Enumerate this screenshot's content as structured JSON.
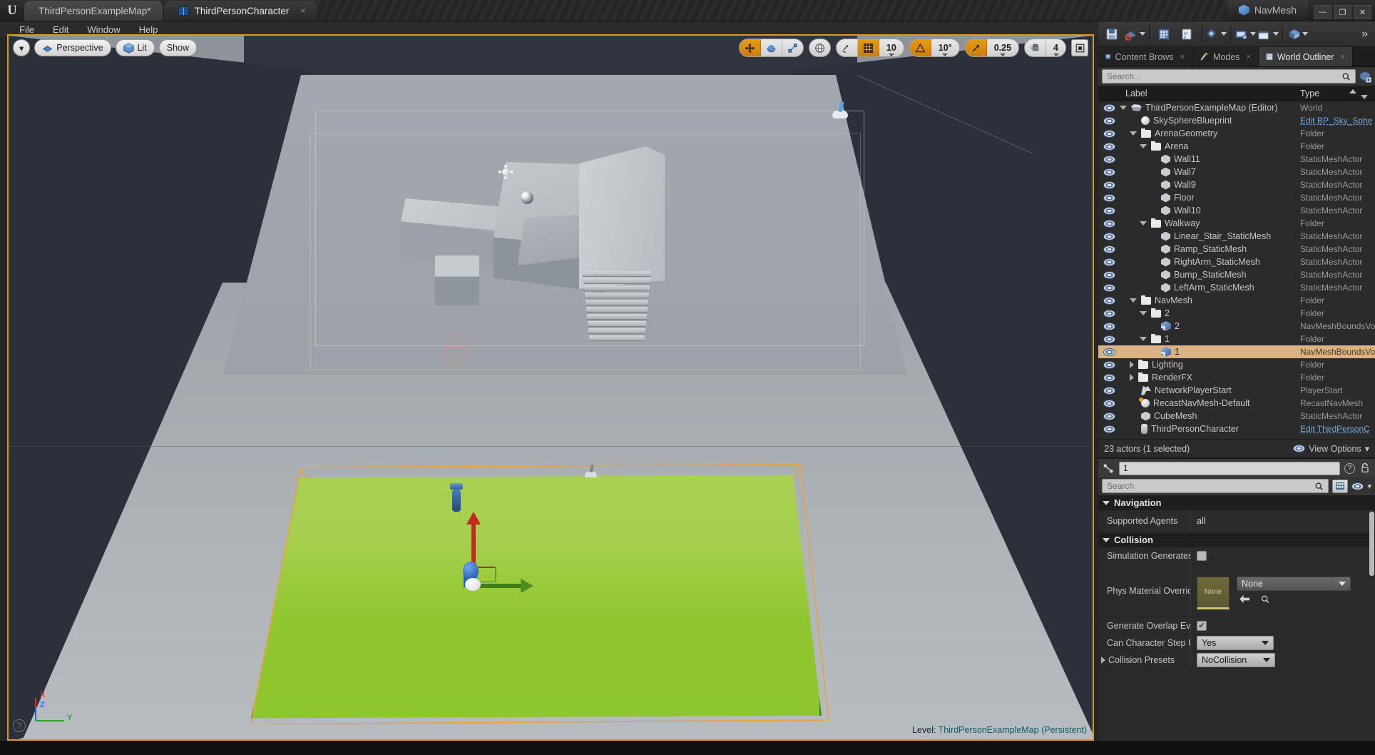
{
  "titlebar": {
    "logo": "unreal-logo",
    "tabs": [
      {
        "label": "ThirdPersonExampleMap*",
        "icon": "map-icon",
        "active": false,
        "close": "×"
      },
      {
        "label": "ThirdPersonCharacter",
        "icon": "blueprint-icon",
        "active": true,
        "close": "×"
      }
    ],
    "project_name": "NavMesh",
    "window_minimize": "—",
    "window_restore": "❐",
    "window_close": "✕"
  },
  "menubar": {
    "items": [
      "File",
      "Edit",
      "Window",
      "Help"
    ]
  },
  "viewport": {
    "view_mode_caret": "▾",
    "perspective_label": "Perspective",
    "lit_label": "Lit",
    "show_label": "Show",
    "transform_modes": [
      "move-widget",
      "rotate-widget",
      "scale-widget"
    ],
    "coordinate_system": "world-globe",
    "surface_snap": "surface-snap-icon",
    "grid_snap_enabled": true,
    "grid_snap_value": "10",
    "angle_snap_value": "10°",
    "scale_snap_value": "0.25",
    "camera_speed_value": "4",
    "maximize_icon": "maximize-viewport-icon",
    "axis_labels": {
      "x": "X",
      "y": "Y",
      "z": "Z"
    },
    "help_glyph": "?",
    "status_level_prefix": "Level:",
    "status_level_name": "ThirdPersonExampleMap (Persistent)"
  },
  "main_toolbar": {
    "buttons": [
      {
        "name": "save-current-level",
        "icon": "save-icon",
        "caret": false
      },
      {
        "name": "source-control",
        "icon": "source-control-icon",
        "caret": true
      },
      {
        "name": "content-browser",
        "icon": "content-icon",
        "caret": false
      },
      {
        "name": "marketplace",
        "icon": "marketplace-icon",
        "caret": false
      },
      {
        "name": "settings",
        "icon": "settings-icon",
        "caret": true
      },
      {
        "name": "blueprints",
        "icon": "blueprint-toolbar-icon",
        "caret": true
      },
      {
        "name": "cinematics",
        "icon": "cinematics-icon",
        "caret": true
      },
      {
        "name": "build",
        "icon": "build-icon",
        "caret": true
      }
    ],
    "overflow": "»"
  },
  "panel_tabs": [
    {
      "label": "Content Brows",
      "icon": "content-browser-icon",
      "active": false,
      "close": "×"
    },
    {
      "label": "Modes",
      "icon": "modes-icon",
      "active": false,
      "close": "×"
    },
    {
      "label": "World Outliner",
      "icon": "outliner-icon",
      "active": true,
      "close": "×"
    }
  ],
  "outliner": {
    "search_placeholder": "Search...",
    "add_button": "add-actor-icon",
    "columns": {
      "label": "Label",
      "type": "Type"
    },
    "rows": [
      {
        "label": "ThirdPersonExampleMap (Editor)",
        "type": "World",
        "indent": 0,
        "icon": "world-icon",
        "expander": "down",
        "selected": false,
        "link": false
      },
      {
        "label": "SkySphereBlueprint",
        "type": "Edit BP_Sky_Sphe",
        "indent": 1,
        "icon": "sphere-icon",
        "expander": "none",
        "selected": false,
        "link": true
      },
      {
        "label": "ArenaGeometry",
        "type": "Folder",
        "indent": 1,
        "icon": "folder-icon",
        "expander": "down",
        "selected": false,
        "link": false
      },
      {
        "label": "Arena",
        "type": "Folder",
        "indent": 2,
        "icon": "folder-icon",
        "expander": "down",
        "selected": false,
        "link": false
      },
      {
        "label": "Wall11",
        "type": "StaticMeshActor",
        "indent": 3,
        "icon": "mesh-icon",
        "expander": "none",
        "selected": false,
        "link": false
      },
      {
        "label": "Wall7",
        "type": "StaticMeshActor",
        "indent": 3,
        "icon": "mesh-icon",
        "expander": "none",
        "selected": false,
        "link": false
      },
      {
        "label": "Wall9",
        "type": "StaticMeshActor",
        "indent": 3,
        "icon": "mesh-icon",
        "expander": "none",
        "selected": false,
        "link": false
      },
      {
        "label": "Floor",
        "type": "StaticMeshActor",
        "indent": 3,
        "icon": "mesh-icon",
        "expander": "none",
        "selected": false,
        "link": false
      },
      {
        "label": "Wall10",
        "type": "StaticMeshActor",
        "indent": 3,
        "icon": "mesh-icon",
        "expander": "none",
        "selected": false,
        "link": false
      },
      {
        "label": "Walkway",
        "type": "Folder",
        "indent": 2,
        "icon": "folder-icon",
        "expander": "down",
        "selected": false,
        "link": false
      },
      {
        "label": "Linear_Stair_StaticMesh",
        "type": "StaticMeshActor",
        "indent": 3,
        "icon": "mesh-icon",
        "expander": "none",
        "selected": false,
        "link": false
      },
      {
        "label": "Ramp_StaticMesh",
        "type": "StaticMeshActor",
        "indent": 3,
        "icon": "mesh-icon",
        "expander": "none",
        "selected": false,
        "link": false
      },
      {
        "label": "RightArm_StaticMesh",
        "type": "StaticMeshActor",
        "indent": 3,
        "icon": "mesh-icon",
        "expander": "none",
        "selected": false,
        "link": false
      },
      {
        "label": "Bump_StaticMesh",
        "type": "StaticMeshActor",
        "indent": 3,
        "icon": "mesh-icon",
        "expander": "none",
        "selected": false,
        "link": false
      },
      {
        "label": "LeftArm_StaticMesh",
        "type": "StaticMeshActor",
        "indent": 3,
        "icon": "mesh-icon",
        "expander": "none",
        "selected": false,
        "link": false
      },
      {
        "label": "NavMesh",
        "type": "Folder",
        "indent": 1,
        "icon": "folder-icon",
        "expander": "down",
        "selected": false,
        "link": false
      },
      {
        "label": "2",
        "type": "Folder",
        "indent": 2,
        "icon": "folder-icon",
        "expander": "down",
        "selected": false,
        "link": false
      },
      {
        "label": "2",
        "type": "NavMeshBoundsVo",
        "indent": 3,
        "icon": "volume-icon",
        "expander": "none",
        "selected": false,
        "link": false
      },
      {
        "label": "1",
        "type": "Folder",
        "indent": 2,
        "icon": "folder-icon",
        "expander": "down",
        "selected": false,
        "link": false
      },
      {
        "label": "1",
        "type": "NavMeshBoundsVo",
        "indent": 3,
        "icon": "volume-icon",
        "expander": "none",
        "selected": true,
        "link": false
      },
      {
        "label": "Lighting",
        "type": "Folder",
        "indent": 1,
        "icon": "folder-icon",
        "expander": "right",
        "selected": false,
        "link": false
      },
      {
        "label": "RenderFX",
        "type": "Folder",
        "indent": 1,
        "icon": "folder-icon",
        "expander": "right",
        "selected": false,
        "link": false
      },
      {
        "label": "NetworkPlayerStart",
        "type": "PlayerStart",
        "indent": 1,
        "icon": "player-start-icon",
        "expander": "none",
        "selected": false,
        "link": false
      },
      {
        "label": "RecastNavMesh-Default",
        "type": "RecastNavMesh",
        "indent": 1,
        "icon": "sphere-orange-icon",
        "expander": "none",
        "selected": false,
        "link": false
      },
      {
        "label": "CubeMesh",
        "type": "StaticMeshActor",
        "indent": 1,
        "icon": "mesh-icon",
        "expander": "none",
        "selected": false,
        "link": false
      },
      {
        "label": "ThirdPersonCharacter",
        "type": "Edit ThirdPersonC",
        "indent": 1,
        "icon": "character-icon",
        "expander": "none",
        "selected": false,
        "link": true
      }
    ],
    "footer_count": "23 actors (1 selected)",
    "view_options_label": "View Options",
    "view_options_caret": "▾"
  },
  "details": {
    "actor_name": "1",
    "help_glyph": "?",
    "lock_icon": "lock-icon",
    "search_placeholder": "Search",
    "search_icon": "search-icon",
    "grid_view_icon": "grid-view-icon",
    "eye_icon": "display-options-icon",
    "eye_caret": "▾",
    "categories": [
      {
        "name": "Navigation",
        "expanded": true,
        "rows": [
          {
            "label": "Supported Agents",
            "type": "text",
            "value": "all"
          }
        ]
      },
      {
        "name": "Collision",
        "expanded": true,
        "rows": [
          {
            "label": "Simulation Generates H",
            "type": "checkbox",
            "value": false
          },
          {
            "label": "Phys Material Override",
            "type": "asset",
            "value": "None",
            "thumb_label": "None",
            "back_icon": "back-arrow-icon",
            "browse_icon": "browse-icon"
          },
          {
            "label": "Generate Overlap Even",
            "type": "checkbox",
            "value": true
          },
          {
            "label": "Can Character Step Up",
            "type": "combo",
            "value": "Yes"
          },
          {
            "label": "Collision Presets",
            "type": "combo",
            "value": "NoCollision",
            "expander": "right"
          }
        ]
      }
    ],
    "scroll_down_caret": "▾"
  },
  "colors": {
    "accent_orange": "#d99a20",
    "selection_tan": "#d9b384",
    "navmesh_green": "#8fc72b",
    "navmesh_green_light": "#a9d14f",
    "navmesh_edge": "#2e8b0f",
    "link_blue": "#6fa8dc",
    "gizmo_x_red": "#c42a1c",
    "gizmo_y_green": "#4c8f1e",
    "gizmo_z_blue": "#1f5fc0"
  }
}
